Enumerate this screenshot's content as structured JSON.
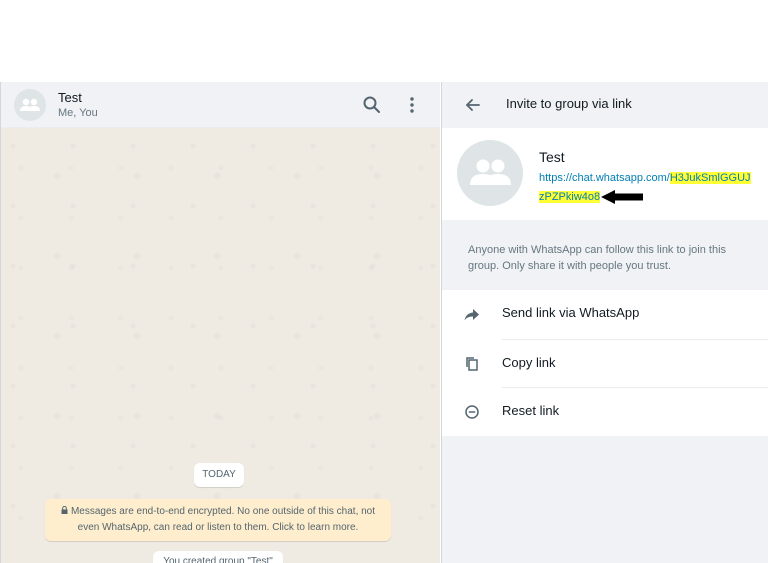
{
  "chat": {
    "title": "Test",
    "subtitle": "Me, You",
    "date_chip": "TODAY",
    "encryption_notice": "Messages are end-to-end encrypted. No one outside of this chat, not even WhatsApp, can read or listen to them. Click to learn more.",
    "system_message": "You created group \"Test\""
  },
  "drawer": {
    "title": "Invite to group via link",
    "group_name": "Test",
    "link_prefix": "https://chat.whatsapp.com/",
    "link_code": "H3JukSmlGGUJzPZPkiw4o8",
    "info": "Anyone with WhatsApp can follow this link to join this group. Only share it with people you trust.",
    "actions": [
      {
        "label": "Send link via WhatsApp",
        "icon": "share-arrow-icon"
      },
      {
        "label": "Copy link",
        "icon": "copy-icon"
      },
      {
        "label": "Reset link",
        "icon": "reset-icon"
      }
    ]
  },
  "colors": {
    "panel_bg": "#f0f2f5",
    "chat_bg": "#efeae2",
    "link": "#027eb5",
    "highlight": "#ffff33",
    "notice_bg": "#ffeecd"
  }
}
